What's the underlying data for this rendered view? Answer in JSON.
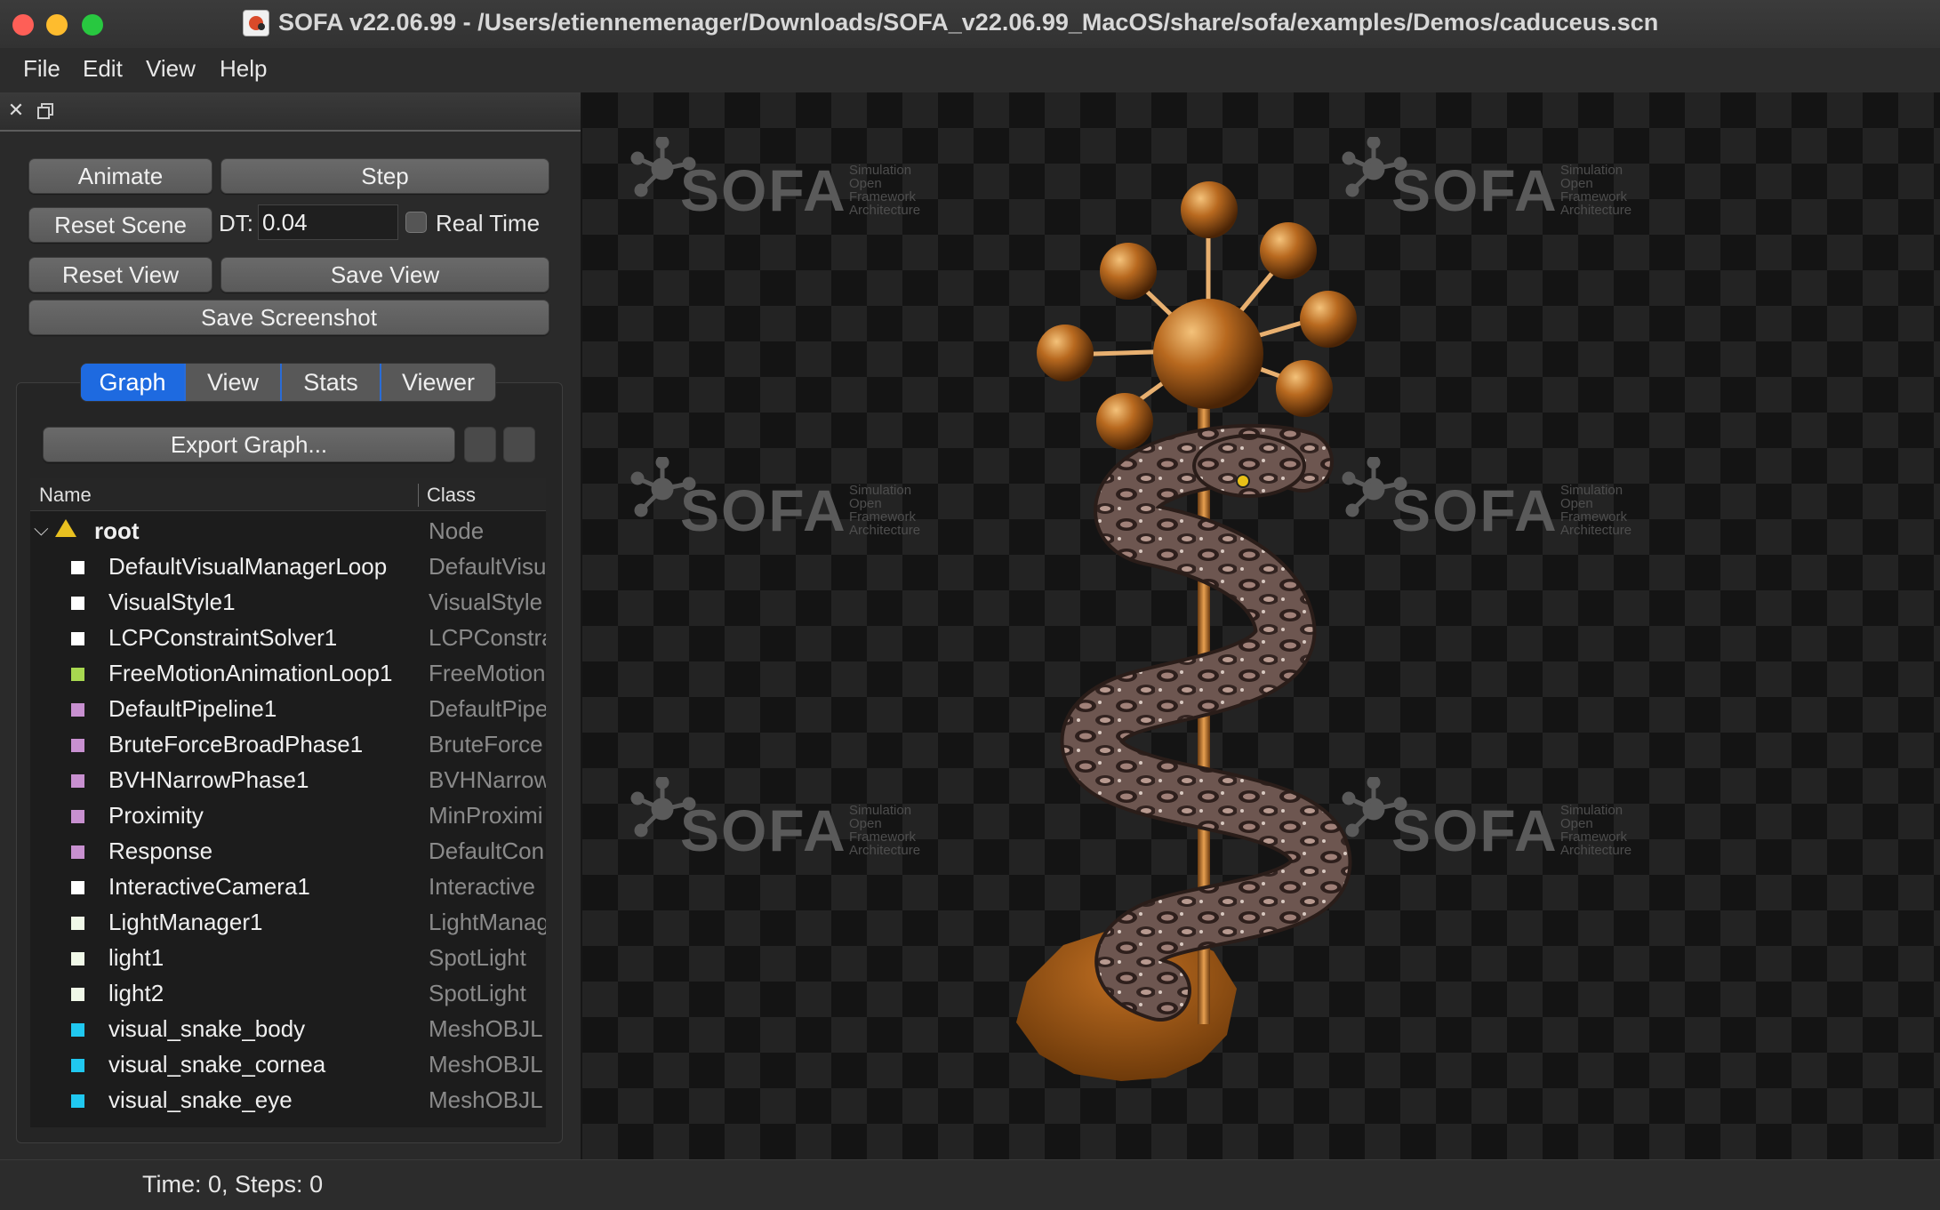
{
  "window": {
    "title": "SOFA v22.06.99 - /Users/etiennemenager/Downloads/SOFA_v22.06.99_MacOS/share/sofa/examples/Demos/caduceus.scn"
  },
  "menu": [
    "File",
    "Edit",
    "View",
    "Help"
  ],
  "controls": {
    "animate": "Animate",
    "step": "Step",
    "reset_scene": "Reset Scene",
    "dt_label": "DT:",
    "dt_value": "0.04",
    "real_time": "Real Time",
    "reset_view": "Reset View",
    "save_view": "Save View",
    "save_screenshot": "Save Screenshot"
  },
  "tabs": [
    "Graph",
    "View",
    "Stats",
    "Viewer"
  ],
  "active_tab": "Graph",
  "export_graph": "Export Graph...",
  "tree": {
    "col_name": "Name",
    "col_class": "Class",
    "root": {
      "name": "root",
      "class": "Node"
    },
    "rows": [
      {
        "name": "DefaultVisualManagerLoop",
        "class": "DefaultVisu",
        "color": "#ffffff"
      },
      {
        "name": "VisualStyle1",
        "class": "VisualStyle",
        "color": "#ffffff"
      },
      {
        "name": "LCPConstraintSolver1",
        "class": "LCPConstra",
        "color": "#ffffff"
      },
      {
        "name": "FreeMotionAnimationLoop1",
        "class": "FreeMotion",
        "color": "#a8d850"
      },
      {
        "name": "DefaultPipeline1",
        "class": "DefaultPipe",
        "color": "#c890d0"
      },
      {
        "name": "BruteForceBroadPhase1",
        "class": "BruteForce",
        "color": "#c890d0"
      },
      {
        "name": "BVHNarrowPhase1",
        "class": "BVHNarrow",
        "color": "#c890d0"
      },
      {
        "name": "Proximity",
        "class": "MinProximi",
        "color": "#c890d0"
      },
      {
        "name": "Response",
        "class": "DefaultCon",
        "color": "#c890d0"
      },
      {
        "name": "InteractiveCamera1",
        "class": "Interactive",
        "color": "#ffffff"
      },
      {
        "name": "LightManager1",
        "class": "LightManag",
        "color": "#f0f8e8"
      },
      {
        "name": "light1",
        "class": "SpotLight",
        "color": "#f0f8e8"
      },
      {
        "name": "light2",
        "class": "SpotLight",
        "color": "#f0f8e8"
      },
      {
        "name": "visual_snake_body",
        "class": "MeshOBJL",
        "color": "#20c8f0"
      },
      {
        "name": "visual_snake_cornea",
        "class": "MeshOBJL",
        "color": "#20c8f0"
      },
      {
        "name": "visual_snake_eye",
        "class": "MeshOBJL",
        "color": "#20c8f0"
      }
    ]
  },
  "viewer": {
    "logo_word": "SOFA",
    "logo_small": [
      "Simulation",
      "Open",
      "Framework",
      "Architecture"
    ]
  },
  "status": "Time: 0,  Steps: 0"
}
